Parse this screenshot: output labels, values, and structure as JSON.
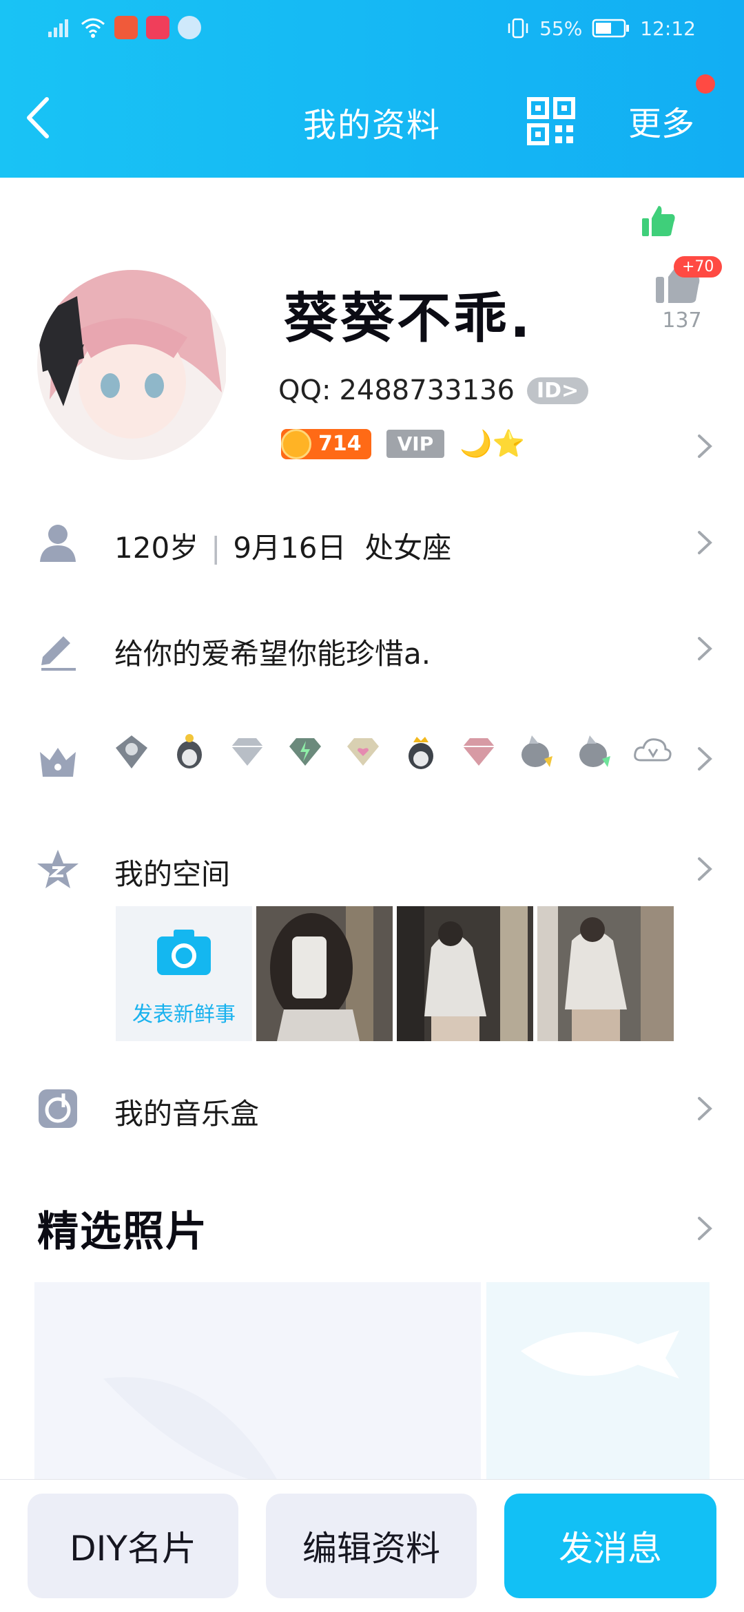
{
  "status_bar": {
    "battery_percent": "55%",
    "time": "12:12"
  },
  "nav": {
    "title": "我的资料",
    "more_label": "更多"
  },
  "profile": {
    "nickname": "葵葵不乖.",
    "qq_label": "QQ:",
    "qq_number": "2488733136",
    "id_label": "ID>",
    "coin_count": "714",
    "vip_label": "VIP",
    "level_icons": "🌙⭐",
    "like_badge": "+70",
    "like_count": "137"
  },
  "rows": {
    "basic_info": {
      "age": "120岁",
      "birthday": "9月16日",
      "zodiac": "处女座"
    },
    "signature": "给你的爱希望你能珍惜a.",
    "space_label": "我的空间",
    "post_new_label": "发表新鲜事",
    "music_label": "我的音乐盒"
  },
  "featured": {
    "title": "精选照片"
  },
  "bottom_bar": {
    "diy_label": "DIY名片",
    "edit_label": "编辑资料",
    "message_label": "发消息"
  },
  "colors": {
    "header_start": "#19c3f5",
    "header_end": "#12aef3",
    "send_button": "#12c0f5",
    "red_dot": "#ff4a43"
  }
}
